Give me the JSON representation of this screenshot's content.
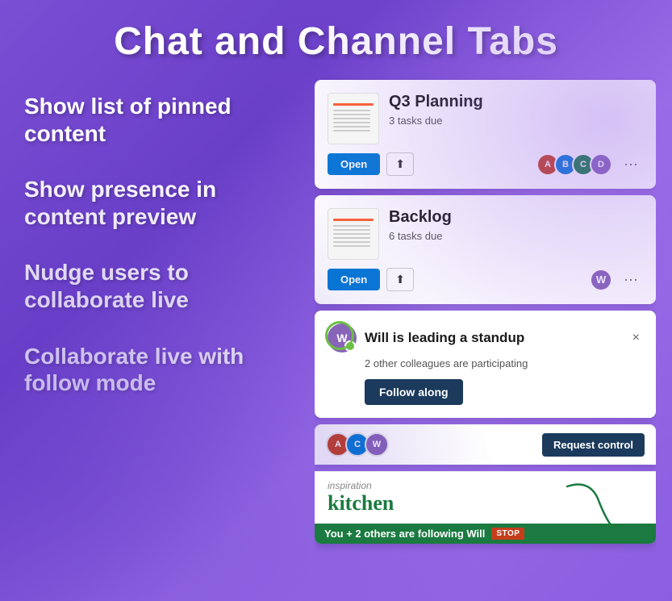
{
  "page": {
    "title": "Chat and Channel Tabs"
  },
  "features": [
    {
      "id": "pinned",
      "label": "Show list of pinned content"
    },
    {
      "id": "presence",
      "label": "Show presence in content preview"
    },
    {
      "id": "nudge",
      "label": "Nudge users to collaborate live"
    },
    {
      "id": "follow",
      "label": "Collaborate live with follow mode"
    }
  ],
  "cards": {
    "q3": {
      "title": "Q3 Planning",
      "subtitle": "3 tasks due",
      "open_label": "Open",
      "more_label": "···"
    },
    "backlog": {
      "title": "Backlog",
      "subtitle": "6 tasks due",
      "open_label": "Open",
      "more_label": "···"
    },
    "standup": {
      "title": "Will is leading a standup",
      "body": "2 other colleagues are participating",
      "follow_label": "Follow along",
      "close_label": "×"
    },
    "live": {
      "request_control_label": "Request control",
      "follow_banner": "You + 2 others are following Will",
      "stop_label": "STOP",
      "wb_text1": "inspiration",
      "wb_text2": "kitchen"
    }
  }
}
